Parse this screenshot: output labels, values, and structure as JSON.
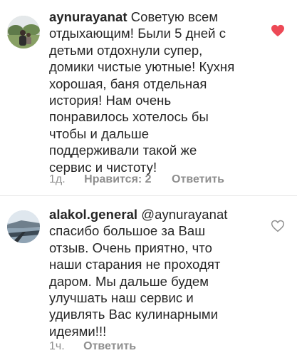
{
  "comments": [
    {
      "username": "aynurayanat",
      "lines": [
        "Советую всем",
        "отдыхающим! Были 5 дней с",
        "детьми отдохнули супер,",
        "домики чистые уютные! Кухня",
        "хорошая, баня отдельная",
        "история! Нам очень",
        "понравилось хотелось бы",
        "чтобы и дальше",
        "поддерживали такой же",
        "сервис и чистоту!"
      ],
      "time": "1д.",
      "likes": "Нравится: 2",
      "reply": "Ответить",
      "liked": true,
      "heart_color": "#ed4956"
    },
    {
      "username": "alakol.general",
      "mention": "@aynurayanat",
      "lines": [
        "спасибо большое за Ваш",
        "отзыв. Очень приятно, что",
        "наши старания не проходят",
        "даром. Мы дальше будем",
        "улучшать наш сервис и",
        "удивлять Вас кулинарными",
        "идеями!!!"
      ],
      "time": "1ч.",
      "reply": "Ответить",
      "liked": false
    }
  ]
}
